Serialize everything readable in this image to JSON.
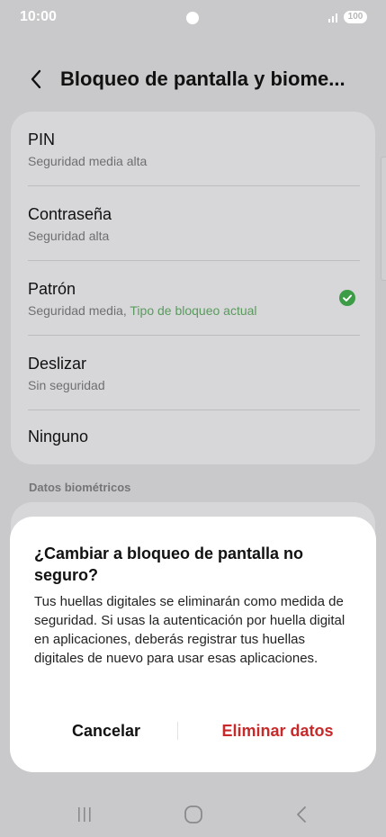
{
  "status_bar": {
    "time": "10:00",
    "battery": "100",
    "icons": [
      "camera-dot-icon",
      "signal-icon",
      "battery-icon"
    ]
  },
  "header": {
    "title": "Bloqueo de pantalla y biome...",
    "back_icon": "chevron-left-icon"
  },
  "lock_options": [
    {
      "title": "PIN",
      "subtitle": "Seguridad media alta"
    },
    {
      "title": "Contraseña",
      "subtitle": "Seguridad alta"
    },
    {
      "title": "Patrón",
      "subtitle": "Seguridad media,",
      "current_label": "Tipo de bloqueo actual",
      "selected": true
    },
    {
      "title": "Deslizar",
      "subtitle": "Sin seguridad"
    },
    {
      "title": "Ninguno"
    }
  ],
  "biometrics": {
    "section_label": "Datos biométricos"
  },
  "dialog": {
    "title": "¿Cambiar a bloqueo de pantalla no seguro?",
    "message": "Tus huellas digitales se eliminarán como medida de seguridad. Si usas la autenticación por huella digital en aplicaciones, deberás registrar tus huellas digitales de nuevo para usar esas aplicaciones.",
    "cancel_label": "Cancelar",
    "confirm_label": "Eliminar datos"
  },
  "colors": {
    "accent_green": "#3d9c46",
    "destructive_red": "#c62a2a",
    "scrim_background": "#c9c9cb"
  },
  "nav_bar": {
    "icons": [
      "recents-icon",
      "home-icon",
      "back-icon"
    ]
  }
}
